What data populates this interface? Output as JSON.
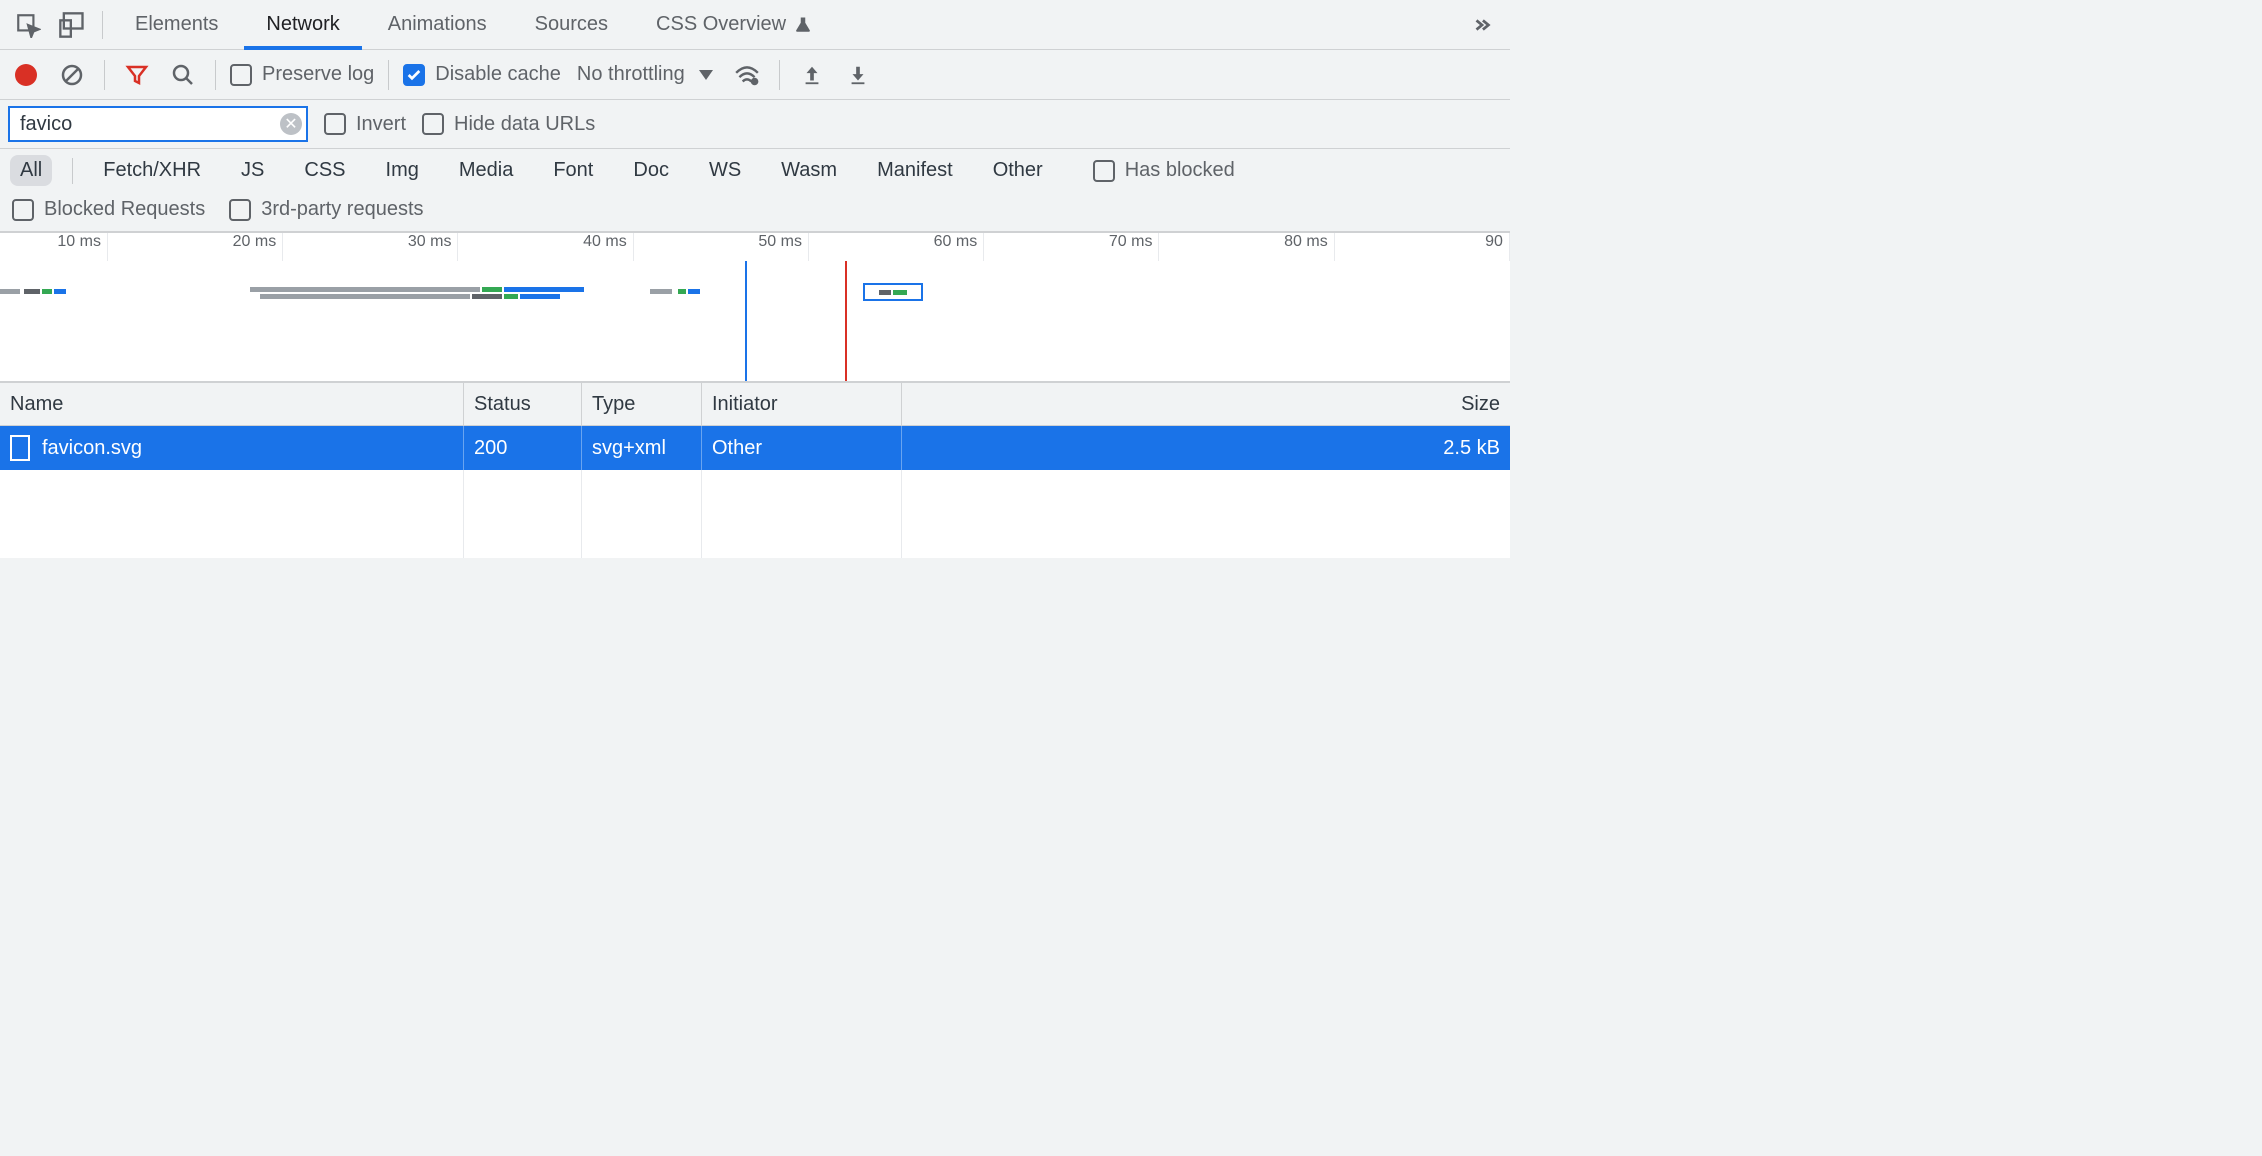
{
  "tabs": {
    "elements": "Elements",
    "network": "Network",
    "animations": "Animations",
    "sources": "Sources",
    "css_overview": "CSS Overview"
  },
  "toolbar": {
    "preserve_log": "Preserve log",
    "disable_cache": "Disable cache",
    "throttling": "No throttling"
  },
  "filter": {
    "value": "favico",
    "invert": "Invert",
    "hide_data_urls": "Hide data URLs"
  },
  "types": {
    "all": "All",
    "fetch_xhr": "Fetch/XHR",
    "js": "JS",
    "css": "CSS",
    "img": "Img",
    "media": "Media",
    "font": "Font",
    "doc": "Doc",
    "ws": "WS",
    "wasm": "Wasm",
    "manifest": "Manifest",
    "other": "Other",
    "has_blocked": "Has blocked"
  },
  "filters2": {
    "blocked_requests": "Blocked Requests",
    "third_party": "3rd-party requests"
  },
  "timeline": {
    "ticks": [
      "10 ms",
      "20 ms",
      "30 ms",
      "40 ms",
      "50 ms",
      "60 ms",
      "70 ms",
      "80 ms",
      "90"
    ]
  },
  "table": {
    "headers": {
      "name": "Name",
      "status": "Status",
      "type": "Type",
      "initiator": "Initiator",
      "size": "Size"
    },
    "rows": [
      {
        "name": "favicon.svg",
        "status": "200",
        "type": "svg+xml",
        "initiator": "Other",
        "size": "2.5 kB"
      }
    ]
  }
}
